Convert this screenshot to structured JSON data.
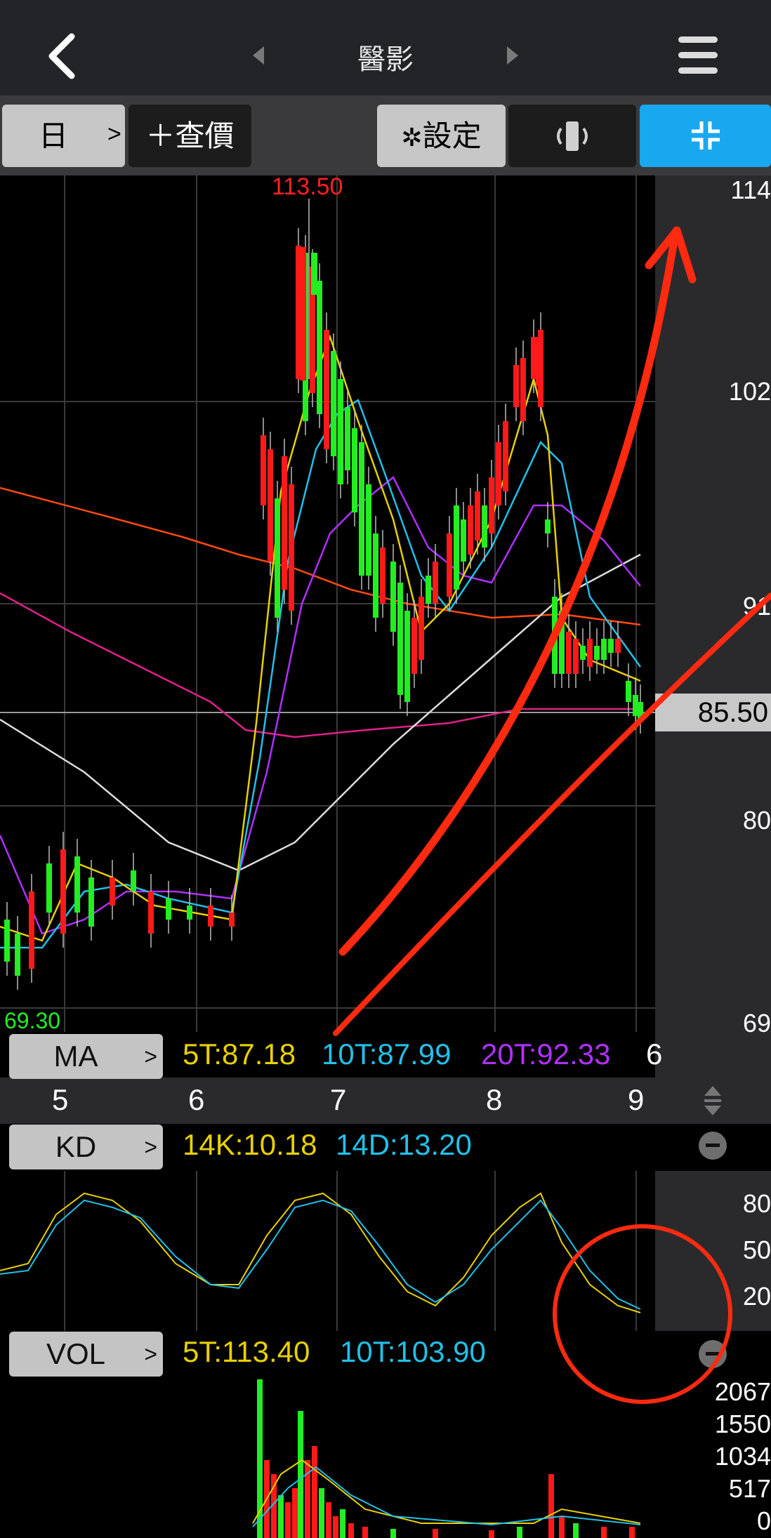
{
  "header": {
    "title": "醫影"
  },
  "toolbar": {
    "period_label": "日",
    "quote_label": "＋查價",
    "settings_label": "設定"
  },
  "price_chart": {
    "y_labels": [
      "114",
      "102",
      "91",
      "80",
      "69"
    ],
    "high_label": "113.50",
    "low_label": "69.30",
    "current_price": "85.50"
  },
  "x_labels": [
    "5",
    "6",
    "7",
    "8",
    "9"
  ],
  "ma": {
    "name": "MA",
    "ma5": "5T:87.18",
    "ma10": "10T:87.99",
    "ma20": "20T:92.33",
    "ma_more": "6"
  },
  "kd": {
    "name": "KD",
    "k": "14K:10.18",
    "d": "14D:13.20",
    "y_labels": [
      "80",
      "50",
      "20"
    ]
  },
  "vol": {
    "name": "VOL",
    "ma5": "5T:113.40",
    "ma10": "10T:103.90",
    "y_labels": [
      "2067",
      "1550",
      "1034",
      "517",
      "0"
    ]
  },
  "colors": {
    "up": "#ff1a1a",
    "down": "#22ee22",
    "ma5": "#e8d000",
    "ma10": "#22c0e8",
    "ma20": "#b030ff",
    "ma60": "#dddddd",
    "ma120": "#e0208a",
    "ma240": "#ff4a10",
    "active": "#18a8f0"
  }
}
